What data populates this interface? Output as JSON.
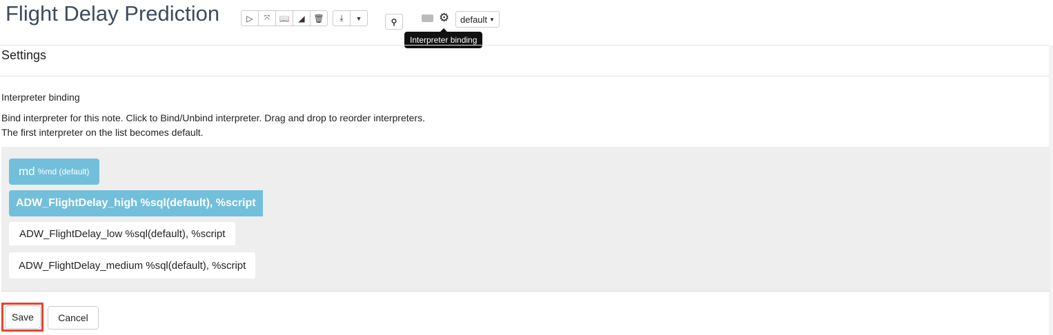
{
  "header": {
    "title": "Flight Delay Prediction",
    "default_label": "default",
    "tooltip": "Interpreter binding"
  },
  "toolbar": {
    "icons": [
      "run-all-icon",
      "collapse-icon",
      "notebook-icon",
      "eraser-icon",
      "trash-icon"
    ]
  },
  "settings": {
    "title": "Settings",
    "section": "Interpreter binding",
    "desc1": "Bind interpreter for this note. Click to Bind/Unbind interpreter. Drag and drop to reorder interpreters.",
    "desc2": "The first interpreter on the list becomes default."
  },
  "interpreters": [
    {
      "name": "md",
      "detail": "%md (default)",
      "bound": true
    },
    {
      "name": "ADW_FlightDelay_high",
      "detail": "%sql(default), %script",
      "bound": true
    },
    {
      "name": "ADW_FlightDelay_low",
      "detail": "%sql(default), %script",
      "bound": false
    },
    {
      "name": "ADW_FlightDelay_medium",
      "detail": "%sql(default), %script",
      "bound": false
    }
  ],
  "actions": {
    "save": "Save",
    "cancel": "Cancel"
  },
  "colors": {
    "bound": "#72bfdc",
    "highlight": "#e8412c"
  }
}
